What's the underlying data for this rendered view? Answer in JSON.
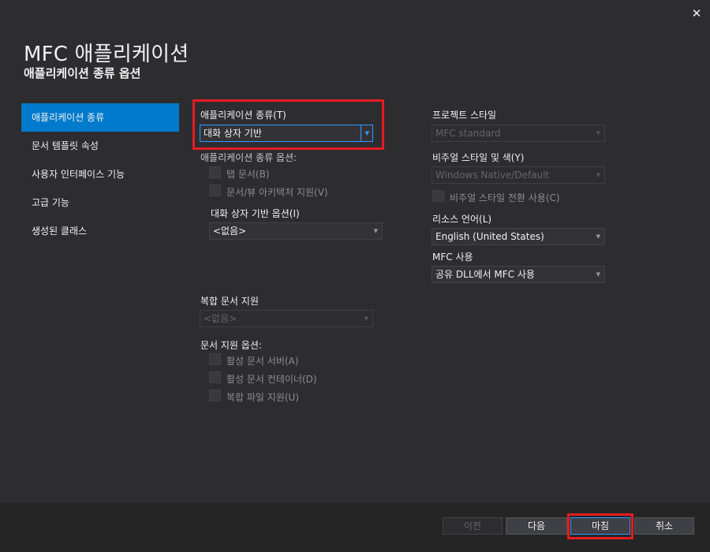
{
  "window": {
    "close_glyph": "✕",
    "title": "MFC 애플리케이션",
    "subtitle": "애플리케이션 종류 옵션"
  },
  "sidebar": {
    "items": [
      {
        "label": "애플리케이션 종류",
        "active": true
      },
      {
        "label": "문서 템플릿 속성",
        "active": false
      },
      {
        "label": "사용자 인터페이스 기능",
        "active": false
      },
      {
        "label": "고급 기능",
        "active": false
      },
      {
        "label": "생성된 클래스",
        "active": false
      }
    ]
  },
  "app_type": {
    "label": "애플리케이션 종류(T)",
    "value": "대화 상자 기반",
    "options_label": "애플리케이션 종류 옵션:",
    "tabbed_docs": "탭 문서(B)",
    "doc_view": "문서/뷰 아키텍처 지원(V)",
    "dialog_options_label": "대화 상자 기반 옵션(I)",
    "dialog_options_value": "<없음>"
  },
  "compound": {
    "label": "복합 문서 지원",
    "value": "<없음>",
    "doc_support_label": "문서 지원 옵션:",
    "active_server": "활성 문서 서버(A)",
    "active_container": "활성 문서 컨테이너(D)",
    "compound_file": "복합 파일 지원(U)"
  },
  "project": {
    "style_label": "프로젝트 스타일",
    "style_value": "MFC standard",
    "visual_label": "비주얼 스타일 및 색(Y)",
    "visual_value": "Windows Native/Default",
    "visual_switch": "비주얼 스타일 전환 사용(C)",
    "resource_label": "리소스 언어(L)",
    "resource_value": "English (United States)",
    "mfc_label": "MFC 사용",
    "mfc_value": "공유 DLL에서 MFC 사용"
  },
  "footer": {
    "prev": "이전",
    "next": "다음",
    "finish": "마침",
    "cancel": "취소"
  },
  "colors": {
    "accent": "#007acc",
    "highlight_border": "#e51c23",
    "background": "#2d2d30"
  }
}
